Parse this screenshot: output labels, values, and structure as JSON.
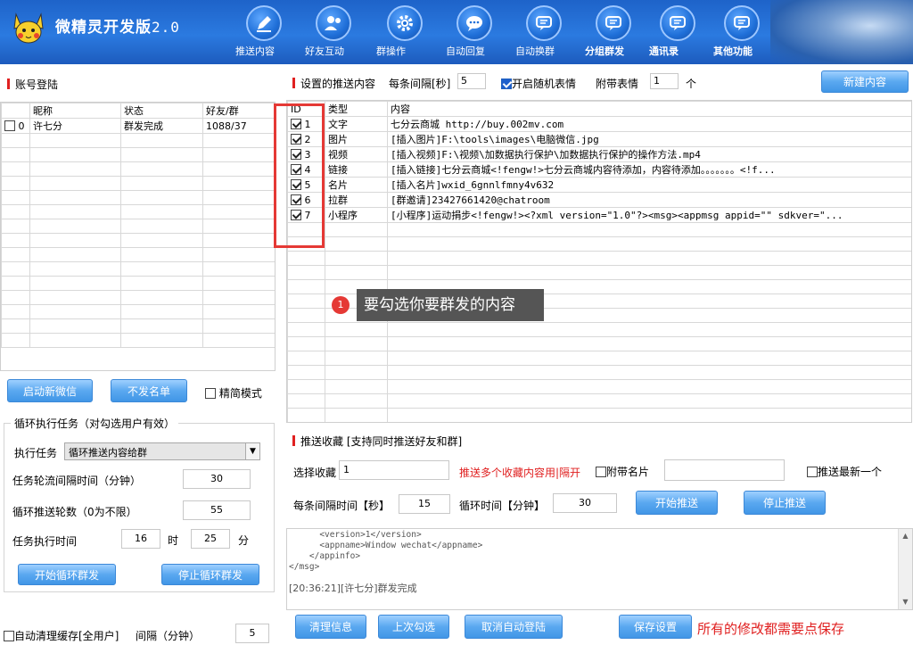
{
  "app": {
    "title": "微精灵开发版",
    "version": "2.0"
  },
  "nav": [
    {
      "label": "推送内容",
      "icon": "pen-icon"
    },
    {
      "label": "好友互动",
      "icon": "users-icon"
    },
    {
      "label": "群操作",
      "icon": "gear-icon"
    },
    {
      "label": "自动回复",
      "icon": "chat-icon"
    },
    {
      "label": "自动换群",
      "icon": "chat-icon"
    },
    {
      "label": "分组群发",
      "icon": "chat-icon"
    },
    {
      "label": "通讯录",
      "icon": "chat-icon"
    },
    {
      "label": "其他功能",
      "icon": "chat-icon"
    }
  ],
  "account": {
    "title": "账号登陆",
    "columns": [
      "昵称",
      "状态",
      "好友/群"
    ],
    "rows": [
      {
        "index": "0",
        "name": "许七分",
        "status": "群发完成",
        "count": "1088/37"
      }
    ],
    "start_btn": "启动新微信",
    "blacklist_btn": "不发名单",
    "compact_mode": "精简模式"
  },
  "loop": {
    "title": "循环执行任务（对勾选用户有效）",
    "task_label": "执行任务",
    "task_value": "循环推送内容给群",
    "interval_label": "任务轮流间隔时间（分钟）",
    "interval_value": "30",
    "rounds_label": "循环推送轮数（0为不限）",
    "rounds_value": "55",
    "time_label": "任务执行时间",
    "hour_value": "16",
    "hour_unit": "时",
    "minute_value": "25",
    "minute_unit": "分",
    "start_btn": "开始循环群发",
    "stop_btn": "停止循环群发"
  },
  "auto_clean": {
    "label": "自动清理缓存[全用户]",
    "interval_label": "间隔（分钟）",
    "interval_value": "5"
  },
  "push": {
    "title": "设置的推送内容",
    "interval_label": "每条间隔[秒]",
    "interval_value": "5",
    "random_emoji": "开启随机表情",
    "attach_label": "附带表情",
    "attach_value": "1",
    "attach_unit": "个",
    "new_btn": "新建内容",
    "columns": [
      "ID",
      "类型",
      "内容"
    ],
    "rows": [
      {
        "id": "1",
        "type": "文字",
        "content": "七分云商城  http://buy.002mv.com"
      },
      {
        "id": "2",
        "type": "图片",
        "content": "[插入图片]F:\\tools\\images\\电脑微信.jpg"
      },
      {
        "id": "3",
        "type": "视频",
        "content": "[插入视频]F:\\视频\\加数据执行保护\\加数据执行保护的操作方法.mp4"
      },
      {
        "id": "4",
        "type": "链接",
        "content": "[插入链接]七分云商城<!fengw!>七分云商城内容待添加，内容待添加。。。。。。。<!f..."
      },
      {
        "id": "5",
        "type": "名片",
        "content": "[插入名片]wxid_6gnnlfmny4v632"
      },
      {
        "id": "6",
        "type": "拉群",
        "content": "[群邀请]23427661420@chatroom"
      },
      {
        "id": "7",
        "type": "小程序",
        "content": "[小程序]运动捐步<!fengw!><?xml version=\"1.0\"?><msg><appmsg appid=\"\" sdkver=\"..."
      }
    ],
    "callout_number": "1",
    "callout_text": "要勾选你要群发的内容"
  },
  "favorites": {
    "title": "推送收藏 [支持同时推送好友和群]",
    "select_label": "选择收藏",
    "select_value": "1",
    "hint": "推送多个收藏内容用|隔开",
    "attach_card": "附带名片",
    "latest": "推送最新一个",
    "interval_label": "每条间隔时间【秒】",
    "interval_value": "15",
    "loop_label": "循环时间【分钟】",
    "loop_value": "30",
    "start_btn": "开始推送",
    "stop_btn": "停止推送"
  },
  "log": {
    "lines": [
      "      <version>1</version>",
      "      <appname>Window wechat</appname>",
      "    </appinfo>",
      "</msg>",
      "",
      "[20:36:21][许七分]群发完成"
    ]
  },
  "footer": {
    "clear_btn": "清理信息",
    "last_btn": "上次勾选",
    "cancel_btn": "取消自动登陆",
    "save_btn": "保存设置",
    "save_note": "所有的修改都需要点保存"
  },
  "colors": {
    "accent_blue": "#4196e6",
    "header_blue": "#1e63c9",
    "warning_red": "#e02020",
    "highlight_box": "#e53935"
  }
}
